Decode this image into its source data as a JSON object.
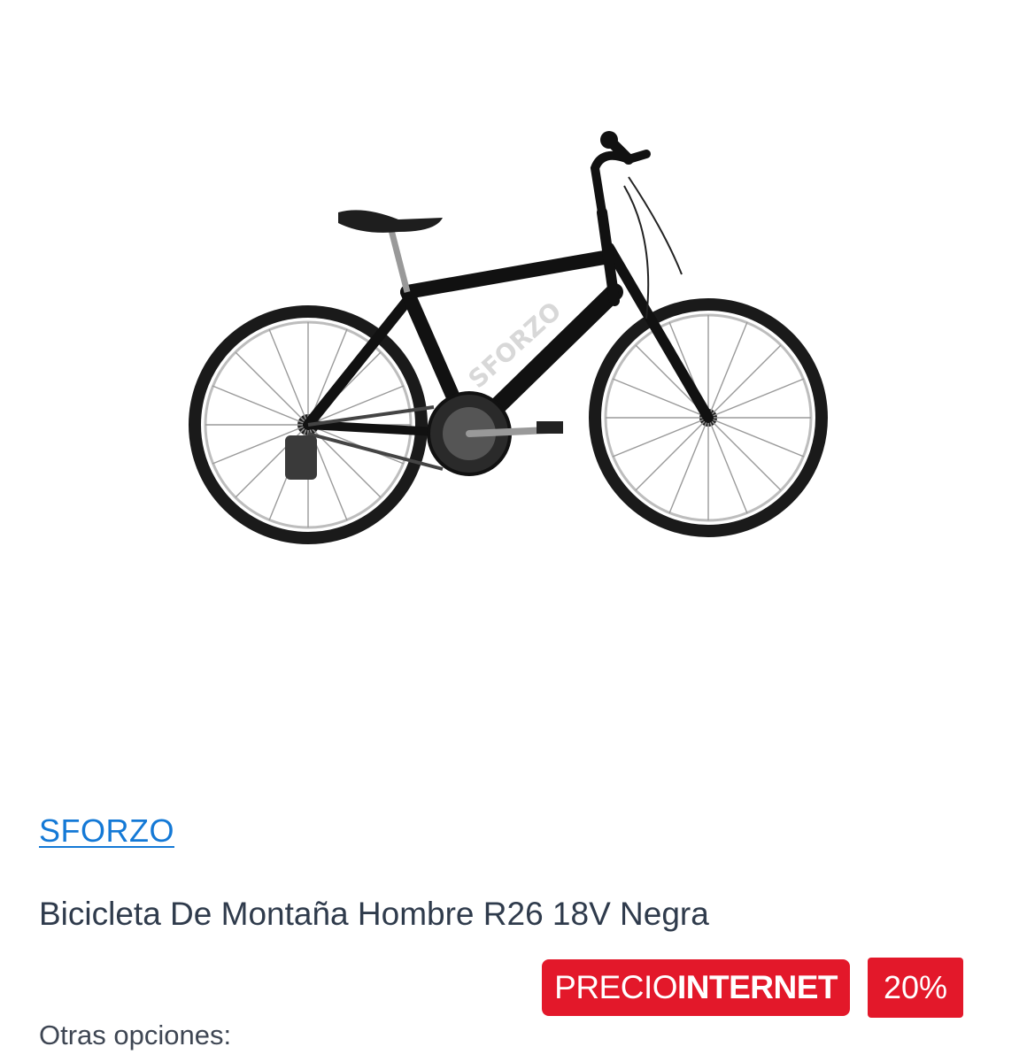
{
  "product": {
    "image_alt": "bicycle-image",
    "brand": "SFORZO",
    "title": "Bicicleta De Montaña Hombre R26 18V Negra",
    "badges": {
      "precio_prefix": "PRECIO",
      "precio_strong": "INTERNET",
      "discount": "20%"
    },
    "other_options_label": "Otras opciones:"
  },
  "colors": {
    "brand_link": "#1479d6",
    "badge_red": "#e3182a",
    "title_text": "#2f3b4c"
  }
}
